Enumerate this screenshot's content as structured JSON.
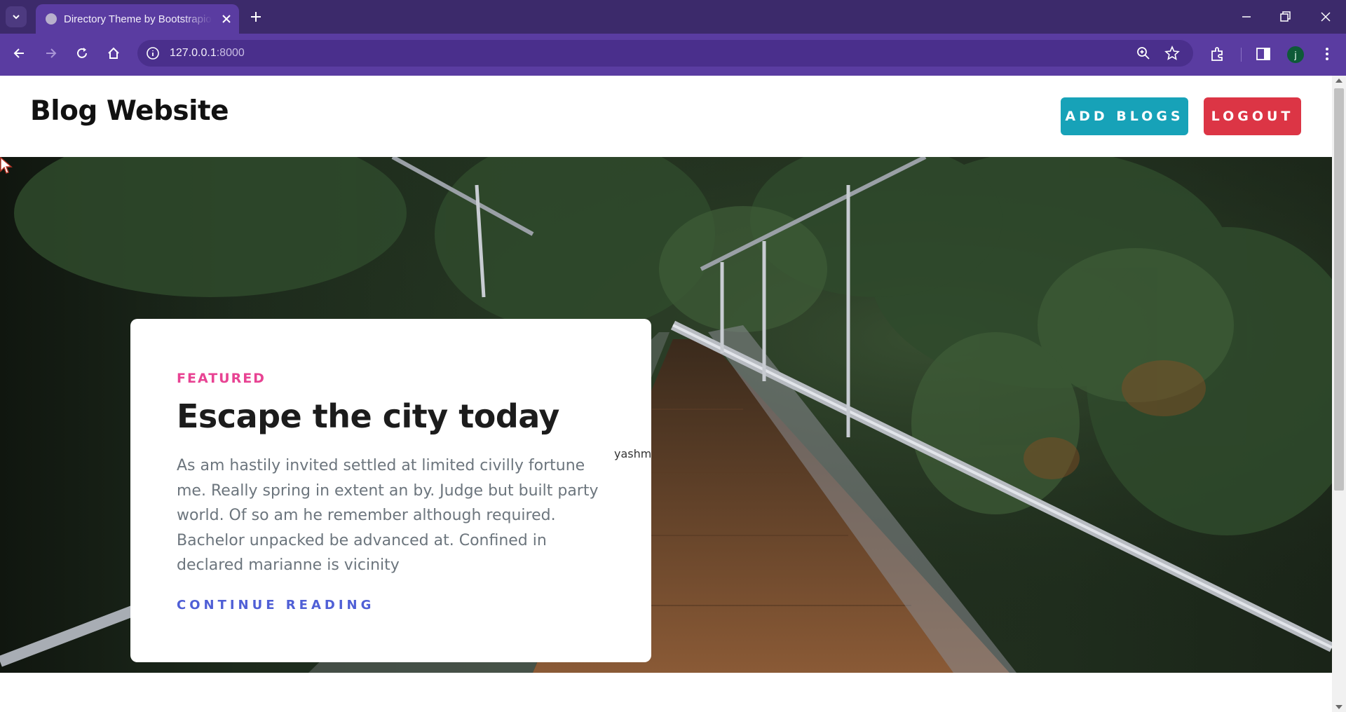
{
  "browser": {
    "tab_title": "Directory Theme by Bootstrapious",
    "url_host": "127.0.0.1",
    "url_port": ":8000",
    "profile_initial": "j"
  },
  "site": {
    "brand": "Blog Website",
    "add_blogs_label": "ADD BLOGS",
    "logout_label": "LOGOUT"
  },
  "featured": {
    "eyebrow": "FEATURED",
    "title": "Escape the city today",
    "text": "As am hastily invited settled at limited civilly fortune me. Really spring in extent an by. Judge but built party world. Of so am he remember although required. Bachelor unpacked be advanced at. Confined in declared marianne is vicinity",
    "link": "CONTINUE READING"
  },
  "cursor_tooltip": "yashm",
  "colors": {
    "tab_bar": "#3c2a6b",
    "toolbar": "#5a3ca1",
    "add_blogs": "#17a2b8",
    "logout": "#dc3545",
    "eyebrow": "#e84393",
    "link": "#4f5fd6"
  }
}
